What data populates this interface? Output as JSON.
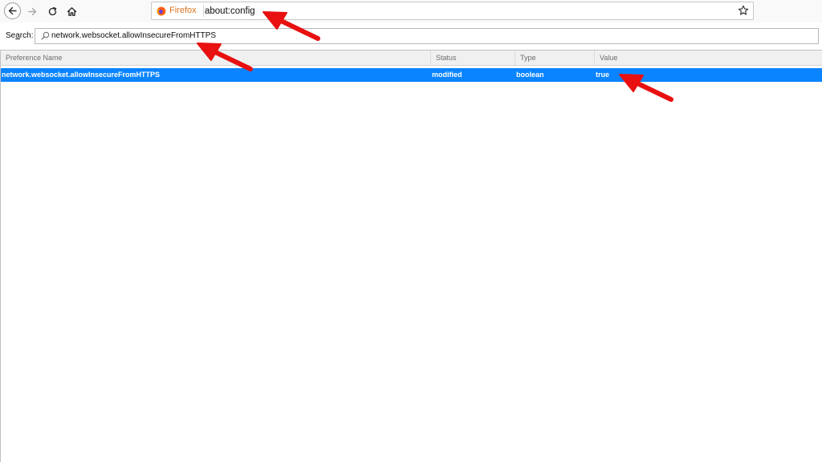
{
  "toolbar": {
    "back_icon": "back-arrow-icon",
    "forward_icon": "forward-arrow-icon",
    "reload_icon": "reload-icon",
    "home_icon": "home-icon"
  },
  "urlbar": {
    "identity_label": "Firefox",
    "url": "about:config",
    "bookmark_icon": "star-icon"
  },
  "search": {
    "label_prefix": "Se",
    "label_accesskey": "a",
    "label_suffix": "rch:",
    "value": "network.websocket.allowInsecureFromHTTPS"
  },
  "table": {
    "columns": [
      "Preference Name",
      "Status",
      "Type",
      "Value"
    ],
    "rows": [
      {
        "name": "network.websocket.allowInsecureFromHTTPS",
        "status": "modified",
        "type": "boolean",
        "value": "true",
        "selected": true
      }
    ]
  },
  "colors": {
    "selection": "#0a84ff",
    "annotation_arrow": "#e81010",
    "identity": "#d7731f"
  }
}
